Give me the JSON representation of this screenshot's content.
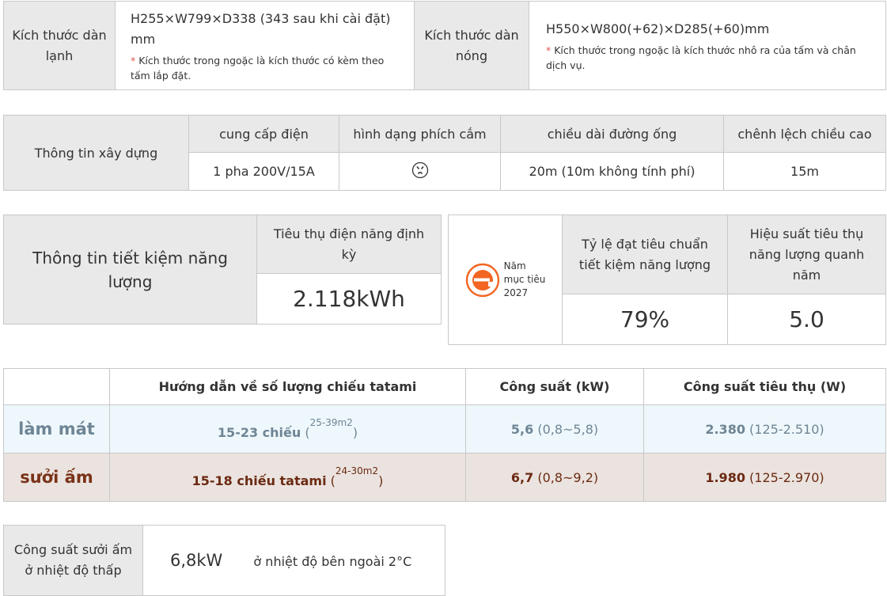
{
  "dims": {
    "indoor_label": "Kích thước dàn lạnh",
    "indoor_value": "H255×W799×D338 (343 sau khi cài đặt) mm",
    "indoor_note": "Kích thước trong ngoặc là kích thước có kèm theo tấm lắp đặt.",
    "outdoor_label": "Kích thước dàn nóng",
    "outdoor_value": "H550×W800(+62)×D285(+60)mm",
    "outdoor_note": "Kích thước trong ngoặc là kích thước nhô ra của tấm và chân dịch vụ.",
    "note_mark": "*"
  },
  "construction": {
    "title": "Thông tin xây dựng",
    "headers": [
      "cung cấp điện",
      "hình dạng phích cắm",
      "chiều dài đường ống",
      "chênh lệch chiều cao"
    ],
    "values": [
      "1 pha 200V/15A",
      "",
      "20m (10m không tính phí)",
      "15m"
    ],
    "plug_icon": "plug-shape-icon"
  },
  "energy": {
    "title": "Thông tin tiết kiệm năng lượng",
    "consumption_label": "Tiêu thụ điện năng định kỳ",
    "consumption_value": "2.118kWh",
    "logo_text": [
      "Năm",
      "mục tiêu",
      "2027"
    ],
    "logo_color": "#f26522",
    "rate_label": "Tỷ lệ đạt tiêu chuẩn tiết kiệm năng lượng",
    "rate_value": "79%",
    "annual_label": "Hiệu suất tiêu thụ năng lượng quanh năm",
    "annual_value": "5.0"
  },
  "performance": {
    "headers": [
      "",
      "Hướng dẫn về số lượng chiếu tatami",
      "Công suất (kW)",
      "Công suất tiêu thụ (W)"
    ],
    "cooling": {
      "label": "làm mát",
      "tatami": "15-23 chiếu",
      "tatami_area": "25-39m2",
      "capacity": "5,6",
      "capacity_range": "(0,8~5,8)",
      "power": "2.380",
      "power_range": "(125-2.510)"
    },
    "heating": {
      "label": "sưởi ấm",
      "tatami": "15-18 chiếu tatami",
      "tatami_area": "24-30m2",
      "capacity": "6,7",
      "capacity_range": "(0,8~9,2)",
      "power": "1.980",
      "power_range": "(125-2.970)"
    },
    "colors": {
      "cool_bg": "#eef7fb",
      "heat_bg": "#ebe3df",
      "cool_text": "#6e8595",
      "heat_text": "#7a3318"
    }
  },
  "lowtemp": {
    "label": "Công suất sưởi ấm ở nhiệt độ thấp",
    "value": "6,8kW",
    "condition": "ở nhiệt độ bên ngoài 2°C"
  }
}
